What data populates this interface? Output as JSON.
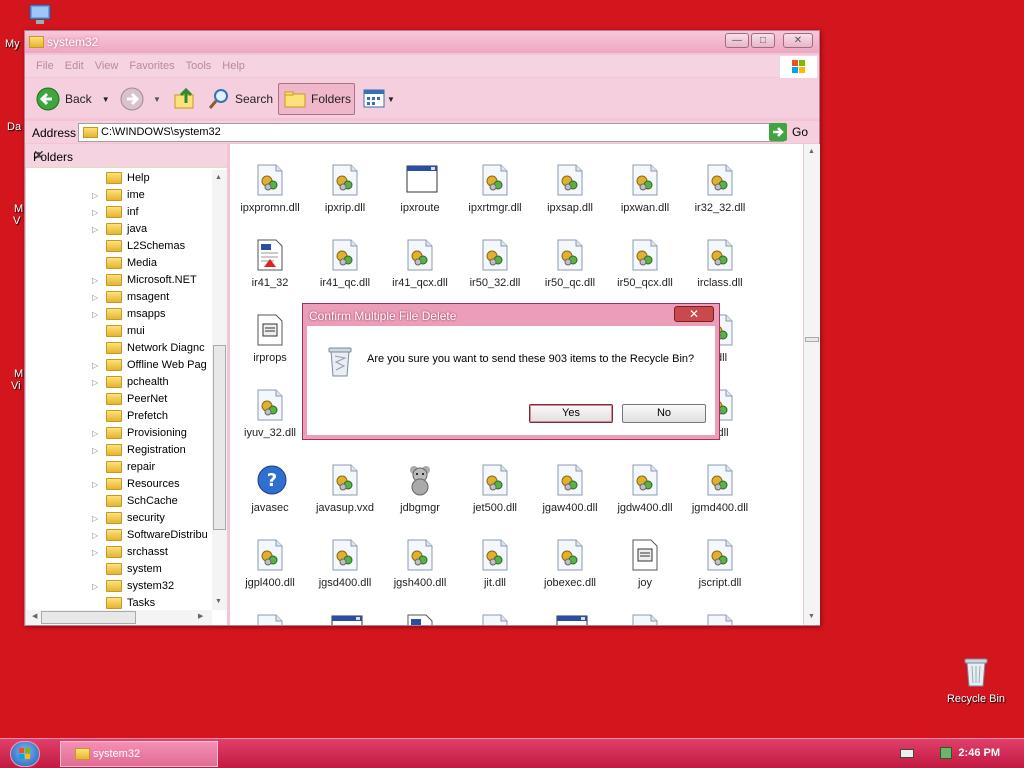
{
  "desktop": {
    "partial_labels": [
      "My",
      "Da",
      "M",
      "V",
      "M",
      "Vi"
    ],
    "recycle_bin_label": "Recycle Bin"
  },
  "window": {
    "title": "system32",
    "menu": [
      "File",
      "Edit",
      "View",
      "Favorites",
      "Tools",
      "Help"
    ],
    "toolbar": {
      "back": "Back",
      "search": "Search",
      "folders": "Folders"
    },
    "address": {
      "label": "Address",
      "value": "C:\\WINDOWS\\system32",
      "go": "Go"
    },
    "folders_pane": {
      "title": "Folders",
      "items": [
        {
          "label": "Help",
          "expand": false
        },
        {
          "label": "ime",
          "expand": true
        },
        {
          "label": "inf",
          "expand": true
        },
        {
          "label": "java",
          "expand": true
        },
        {
          "label": "L2Schemas",
          "expand": false
        },
        {
          "label": "Media",
          "expand": false
        },
        {
          "label": "Microsoft.NET",
          "expand": true
        },
        {
          "label": "msagent",
          "expand": true
        },
        {
          "label": "msapps",
          "expand": true
        },
        {
          "label": "mui",
          "expand": false
        },
        {
          "label": "Network Diagnc",
          "expand": false
        },
        {
          "label": "Offline Web Pag",
          "expand": true
        },
        {
          "label": "pchealth",
          "expand": true
        },
        {
          "label": "PeerNet",
          "expand": false
        },
        {
          "label": "Prefetch",
          "expand": false
        },
        {
          "label": "Provisioning",
          "expand": true
        },
        {
          "label": "Registration",
          "expand": true
        },
        {
          "label": "repair",
          "expand": false
        },
        {
          "label": "Resources",
          "expand": true
        },
        {
          "label": "SchCache",
          "expand": false
        },
        {
          "label": "security",
          "expand": true
        },
        {
          "label": "SoftwareDistribu",
          "expand": true
        },
        {
          "label": "srchasst",
          "expand": true
        },
        {
          "label": "system",
          "expand": false
        },
        {
          "label": "system32",
          "expand": true
        },
        {
          "label": "Tasks",
          "expand": false
        }
      ]
    },
    "files": [
      {
        "name": "ipxpromn.dll",
        "icon": "dll-icon"
      },
      {
        "name": "ipxrip.dll",
        "icon": "dll-icon"
      },
      {
        "name": "ipxroute",
        "icon": "exe-window-icon"
      },
      {
        "name": "ipxrtmgr.dll",
        "icon": "dll-icon"
      },
      {
        "name": "ipxsap.dll",
        "icon": "dll-icon"
      },
      {
        "name": "ipxwan.dll",
        "icon": "dll-icon"
      },
      {
        "name": "ir32_32.dll",
        "icon": "dll-icon"
      },
      {
        "name": "ir41_32",
        "icon": "document-icon"
      },
      {
        "name": "ir41_qc.dll",
        "icon": "dll-icon"
      },
      {
        "name": "ir41_qcx.dll",
        "icon": "dll-icon"
      },
      {
        "name": "ir50_32.dll",
        "icon": "dll-icon"
      },
      {
        "name": "ir50_qc.dll",
        "icon": "dll-icon"
      },
      {
        "name": "ir50_qcx.dll",
        "icon": "dll-icon"
      },
      {
        "name": "irclass.dll",
        "icon": "dll-icon"
      },
      {
        "name": "irprops",
        "icon": "settings-file-icon"
      },
      {
        "name": "",
        "icon": "hidden"
      },
      {
        "name": "",
        "icon": "hidden"
      },
      {
        "name": "",
        "icon": "hidden"
      },
      {
        "name": "",
        "icon": "hidden"
      },
      {
        "name": "",
        "icon": "hidden"
      },
      {
        "name": ".dll",
        "icon": "dll-icon"
      },
      {
        "name": "iyuv_32.dll",
        "icon": "dll-icon"
      },
      {
        "name": "",
        "icon": "hidden"
      },
      {
        "name": "",
        "icon": "hidden"
      },
      {
        "name": "",
        "icon": "hidden"
      },
      {
        "name": "",
        "icon": "hidden"
      },
      {
        "name": "",
        "icon": "hidden"
      },
      {
        "name": "t.dll",
        "icon": "dll-icon"
      },
      {
        "name": "javasec",
        "icon": "help-icon"
      },
      {
        "name": "javasup.vxd",
        "icon": "dll-icon"
      },
      {
        "name": "jdbgmgr",
        "icon": "bear-icon"
      },
      {
        "name": "jet500.dll",
        "icon": "dll-icon"
      },
      {
        "name": "jgaw400.dll",
        "icon": "dll-icon"
      },
      {
        "name": "jgdw400.dll",
        "icon": "dll-icon"
      },
      {
        "name": "jgmd400.dll",
        "icon": "dll-icon"
      },
      {
        "name": "jgpl400.dll",
        "icon": "dll-icon"
      },
      {
        "name": "jgsd400.dll",
        "icon": "dll-icon"
      },
      {
        "name": "jgsh400.dll",
        "icon": "dll-icon"
      },
      {
        "name": "jit.dll",
        "icon": "dll-icon"
      },
      {
        "name": "jobexec.dll",
        "icon": "dll-icon"
      },
      {
        "name": "joy",
        "icon": "settings-file-icon"
      },
      {
        "name": "jscript.dll",
        "icon": "dll-icon"
      }
    ]
  },
  "dialog": {
    "title": "Confirm Multiple File Delete",
    "message": "Are you sure you want to send these 903 items to the Recycle Bin?",
    "yes": "Yes",
    "no": "No"
  },
  "taskbar": {
    "task_label": "system32",
    "clock": "2:46 PM"
  },
  "colors": {
    "desktop": "#d3151e",
    "window_frame": "#f3c3d6",
    "taskbar": "#c21941"
  }
}
